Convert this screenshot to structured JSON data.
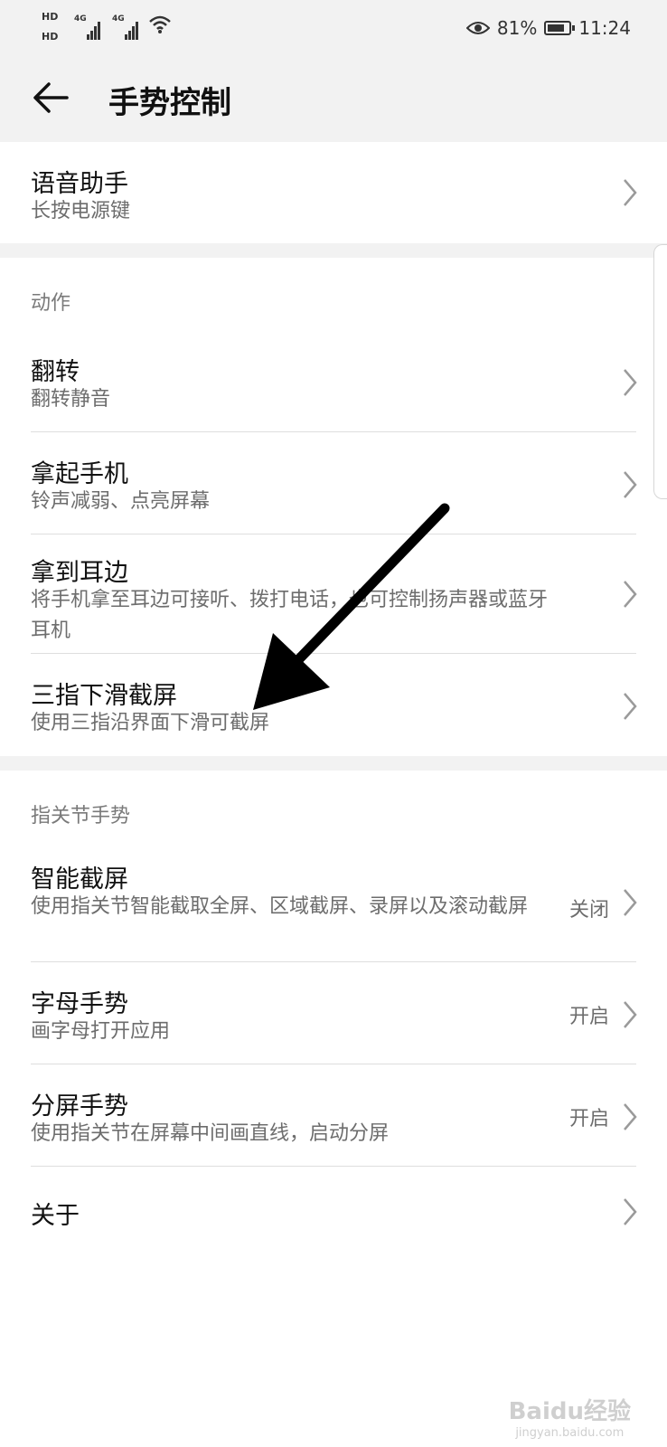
{
  "status_bar": {
    "hd1": "HD",
    "hd2": "HD",
    "net1": "4G",
    "net2": "4G",
    "battery_percent": "81%",
    "time": "11:24",
    "battery_level": 0.81,
    "icons": [
      "signal-icon",
      "wifi-icon",
      "eye-icon",
      "battery-icon"
    ]
  },
  "header": {
    "title": "手势控制",
    "back_icon": "back-arrow-icon"
  },
  "top_item": {
    "title": "语音助手",
    "subtitle": "长按电源键"
  },
  "section_actions": {
    "header": "动作",
    "items": [
      {
        "title": "翻转",
        "subtitle": "翻转静音"
      },
      {
        "title": "拿起手机",
        "subtitle": "铃声减弱、点亮屏幕"
      },
      {
        "title": "拿到耳边",
        "subtitle": "将手机拿至耳边可接听、拨打电话，也可控制扬声器或蓝牙耳机"
      },
      {
        "title": "三指下滑截屏",
        "subtitle": "使用三指沿界面下滑可截屏"
      }
    ]
  },
  "section_knuckle": {
    "header": "指关节手势",
    "items": [
      {
        "title": "智能截屏",
        "subtitle": "使用指关节智能截取全屏、区域截屏、录屏以及滚动截屏",
        "value": "关闭"
      },
      {
        "title": "字母手势",
        "subtitle": "画字母打开应用",
        "value": "开启"
      },
      {
        "title": "分屏手势",
        "subtitle": "使用指关节在屏幕中间画直线，启动分屏",
        "value": "开启"
      },
      {
        "title": "关于"
      }
    ]
  },
  "watermark": {
    "brand": "Baidu经验",
    "url": "jingyan.baidu.com"
  }
}
